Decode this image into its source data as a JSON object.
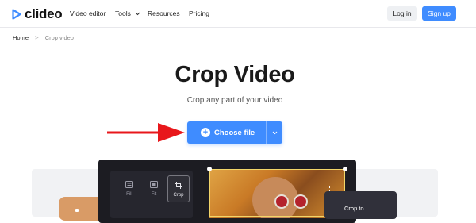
{
  "brand": {
    "name": "clideo",
    "accent": "#3f8cff"
  },
  "nav": {
    "video_editor": "Video editor",
    "tools": "Tools",
    "resources": "Resources",
    "pricing": "Pricing"
  },
  "auth": {
    "login": "Log in",
    "signup": "Sign up"
  },
  "breadcrumb": {
    "home": "Home",
    "separator": ">",
    "current": "Crop video"
  },
  "hero": {
    "title": "Crop Video",
    "subtitle": "Crop any part of your video",
    "choose_file": "Choose file"
  },
  "editor": {
    "tools": [
      {
        "label": "Fill",
        "icon": "fill-icon"
      },
      {
        "label": "Fit",
        "icon": "fit-icon"
      },
      {
        "label": "Crop",
        "icon": "crop-icon",
        "active": true
      }
    ],
    "popup_label": "Crop to"
  },
  "annotation": {
    "arrow_color": "#e8171b"
  }
}
